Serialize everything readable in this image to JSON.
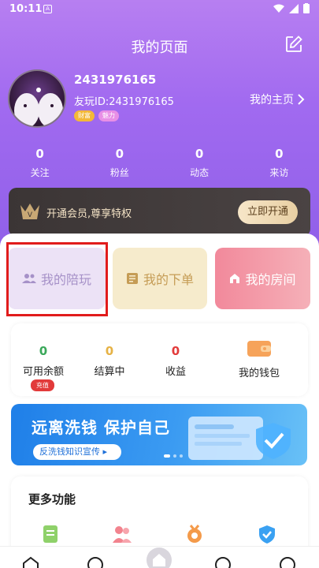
{
  "status_bar": {
    "time": "10:11"
  },
  "header": {
    "title": "我的页面"
  },
  "profile": {
    "username": "2431976165",
    "id_text": "友玩ID:2431976165",
    "badges": [
      "财富",
      "魅力"
    ],
    "homepage_link": "我的主页"
  },
  "stats": [
    {
      "value": "0",
      "label": "关注"
    },
    {
      "value": "0",
      "label": "粉丝"
    },
    {
      "value": "0",
      "label": "动态"
    },
    {
      "value": "0",
      "label": "来访"
    }
  ],
  "vip": {
    "text": "开通会员,尊享特权",
    "button": "立即开通"
  },
  "cards": {
    "play": "我的陪玩",
    "orders": "我的下单",
    "room": "我的房间"
  },
  "wallet": {
    "balance": {
      "value": "0",
      "label": "可用余额",
      "value_color": "#3aa85a"
    },
    "settling": {
      "value": "0",
      "label": "结算中",
      "value_color": "#e6b245"
    },
    "income": {
      "value": "0",
      "label": "收益",
      "value_color": "#e23a3a"
    },
    "wallet_label": "我的钱包",
    "charge_label": "充值"
  },
  "banner": {
    "title": "远离洗钱 保护自己",
    "subtitle": "反洗钱知识宣传"
  },
  "more": {
    "title": "更多功能"
  },
  "colors": {
    "accent": "#9a66ee",
    "highlight": "#e11c1c"
  }
}
